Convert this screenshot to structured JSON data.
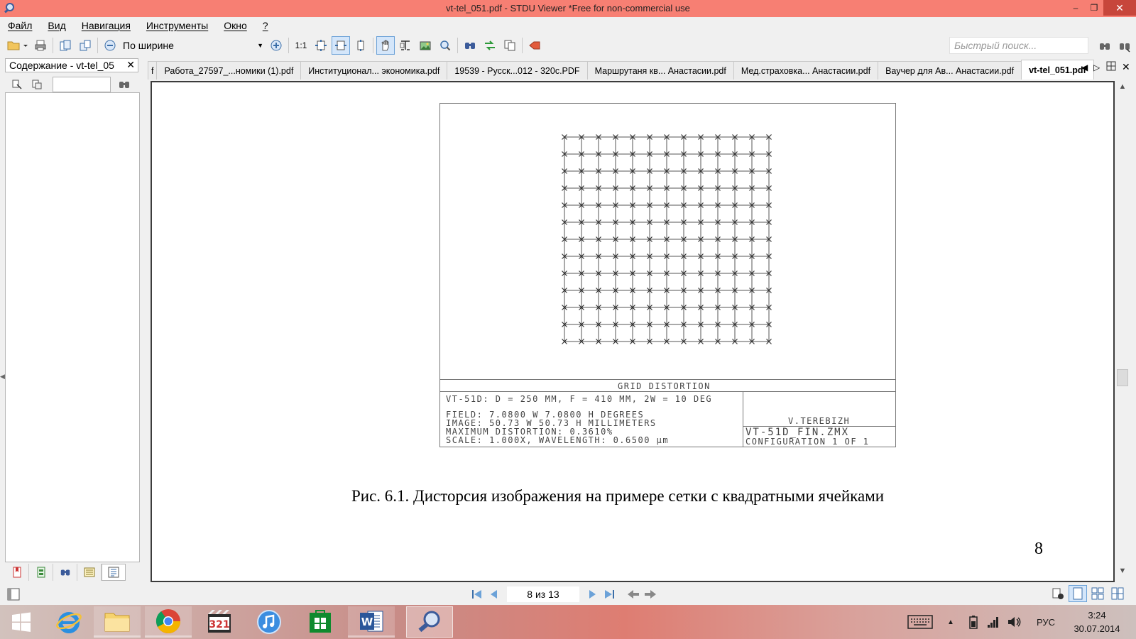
{
  "window": {
    "title": "vt-tel_051.pdf - STDU Viewer *Free for non-commercial use",
    "minimize": "–",
    "maximize": "❐",
    "close": "✕"
  },
  "menu": {
    "items": [
      "Файл",
      "Вид",
      "Навигация",
      "Инструменты",
      "Окно",
      "?"
    ]
  },
  "toolbar": {
    "zoom_value": "По ширине",
    "actual_size": "1:1",
    "quick_search_placeholder": "Быстрый поиск..."
  },
  "left_panel": {
    "header": "Содержание - vt-tel_05",
    "close": "✕"
  },
  "tabs": [
    {
      "label": "f"
    },
    {
      "label": "Работа_27597_...номики (1).pdf"
    },
    {
      "label": "Институционал... экономика.pdf"
    },
    {
      "label": "19539 - Русск...012 - 320c.PDF"
    },
    {
      "label": "Маршрутаня кв... Анастасии.pdf"
    },
    {
      "label": "Мед.страховка... Анастасии.pdf"
    },
    {
      "label": "Ваучер для Ав... Анастасии.pdf"
    },
    {
      "label": "vt-tel_051.pdf",
      "active": true
    }
  ],
  "document": {
    "figure": {
      "title": "GRID DISTORTION",
      "info_line1": "VT-51D: D = 250 MM, F = 410 MM, 2W = 10 DEG",
      "info_line2": "FIELD: 7.0800 W 7.0800 H DEGREES",
      "info_line3": "IMAGE: 50.73 W 50.73 H MILLIMETERS",
      "info_line4": "MAXIMUM DISTORTION: 0.3610%",
      "info_line5": "SCALE: 1.000X, WAVELENGTH: 0.6500 µm",
      "author": "V.TEREBIZH",
      "file": "VT-51D_FIN.ZMX",
      "config": "CONFIGURATION 1 OF 1"
    },
    "caption": "Рис. 6.1. Дисторсия изображения на примере сетки с квадратными ячейками",
    "page_number": "8"
  },
  "navigation": {
    "page_indicator": "8 из 13"
  },
  "taskbar": {
    "tray_language": "РУС",
    "time": "3:24",
    "date": "30.07.2014"
  },
  "colors": {
    "titlebar": "#f77f73",
    "close_button": "#c7463b",
    "accent": "#6ca2d8"
  }
}
